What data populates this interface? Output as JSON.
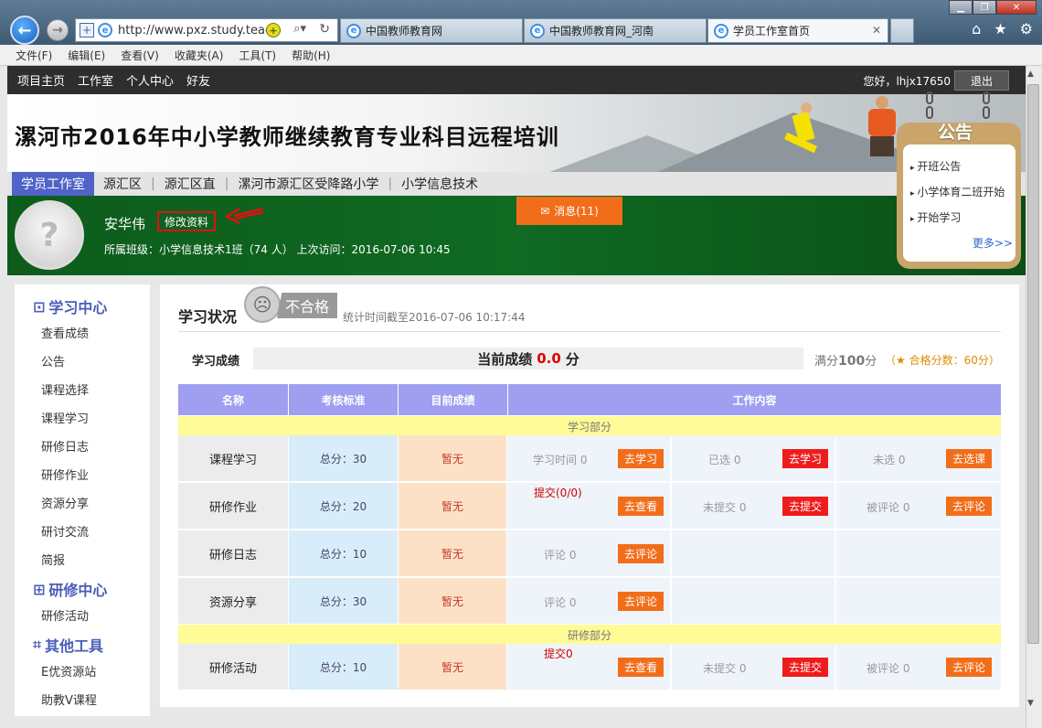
{
  "browser": {
    "url": "http://www.pxz.study.teac",
    "tabs": [
      {
        "label": "中国教师教育网"
      },
      {
        "label": "中国教师教育网_河南"
      },
      {
        "label": "学员工作室首页"
      }
    ],
    "menu": [
      "文件(F)",
      "编辑(E)",
      "查看(V)",
      "收藏夹(A)",
      "工具(T)",
      "帮助(H)"
    ]
  },
  "topnav": {
    "items": [
      "项目主页",
      "工作室",
      "个人中心",
      "好友"
    ],
    "greeting": "您好，lhjx17650",
    "logout_label": "退出"
  },
  "banner": {
    "title": "漯河市2016年中小学教师继续教育专业科目远程培训"
  },
  "subnav": {
    "items": [
      "学员工作室",
      "源汇区",
      "源汇区直",
      "漯河市源汇区受降路小学",
      "小学信息技术"
    ]
  },
  "profile": {
    "name": "安华伟",
    "edit_label": "修改资料",
    "class_info": "所属班级：小学信息技术1班（74 人） 上次访问：2016-07-06 10:45",
    "message_label": "消息(11)"
  },
  "notice": {
    "title": "公告",
    "items": [
      "开班公告",
      "小学体育二班开始",
      "开始学习"
    ],
    "more_label": "更多>>"
  },
  "sidebar": {
    "sections": [
      {
        "title": "学习中心",
        "items": [
          "查看成绩",
          "公告",
          "课程选择",
          "课程学习",
          "研修日志",
          "研修作业",
          "资源分享",
          "研讨交流",
          "简报"
        ]
      },
      {
        "title": "研修中心",
        "items": [
          "研修活动"
        ]
      },
      {
        "title": "其他工具",
        "items": [
          "E优资源站",
          "助教V课程"
        ]
      }
    ]
  },
  "status": {
    "title": "学习状况",
    "result_badge": "不合格",
    "stat_time": "统计时间截至2016-07-06 10:17:44",
    "score_label": "学习成绩",
    "score_prefix": "当前成绩",
    "score_value": "0.0",
    "score_unit": "分",
    "full_prefix": "满分",
    "full_value": "100",
    "full_unit": "分",
    "pass_text": "（★ 合格分数：60分）"
  },
  "table": {
    "headers": [
      "名称",
      "考核标准",
      "目前成绩",
      "工作内容"
    ],
    "section_study": "学习部分",
    "section_research": "研修部分",
    "rows": [
      {
        "name": "课程学习",
        "std": "总分：30",
        "cur": "暂无",
        "w1_label": "学习时间 0",
        "w1_btn": "去学习",
        "w2_label": "已选 0",
        "w2_btn": "去学习",
        "w3_label": "未选 0",
        "w3_btn": "去选课"
      },
      {
        "name": "研修作业",
        "std": "总分：20",
        "cur": "暂无",
        "w1_red": "提交(0/0)",
        "w1_btn": "去查看",
        "w2_label": "未提交 0",
        "w2_btn": "去提交",
        "w3_label": "被评论 0",
        "w3_btn": "去评论"
      },
      {
        "name": "研修日志",
        "std": "总分：10",
        "cur": "暂无",
        "w1_label": "评论 0",
        "w1_btn": "去评论"
      },
      {
        "name": "资源分享",
        "std": "总分：30",
        "cur": "暂无",
        "w1_label": "评论 0",
        "w1_btn": "去评论"
      },
      {
        "name": "研修活动",
        "std": "总分：10",
        "cur": "暂无",
        "w1_red": "提交0",
        "w1_btn": "去查看",
        "w2_label": "未提交 0",
        "w2_btn": "去提交",
        "w3_label": "被评论 0",
        "w3_btn": "去评论"
      }
    ]
  },
  "colors": {
    "accent": "#4f63c8",
    "header_bg": "#9f9ef0",
    "orange_btn": "#f26d1a",
    "red_btn": "#ee1c1c",
    "profile_green": "#0f6a22"
  }
}
